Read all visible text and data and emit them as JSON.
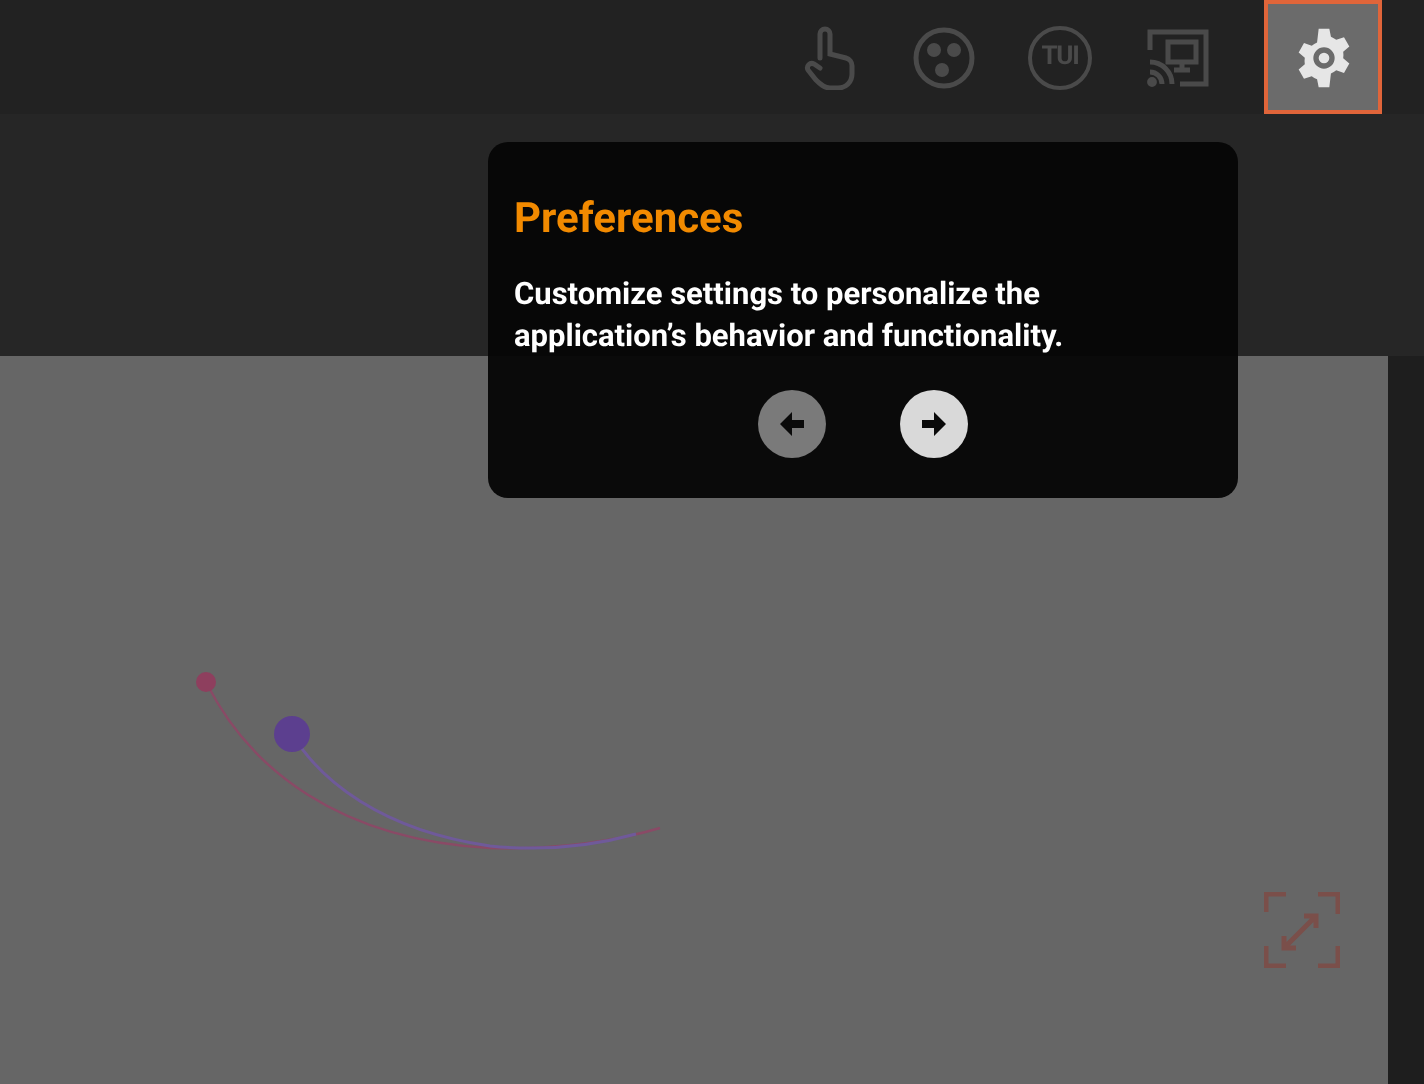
{
  "toolbar": [
    {
      "kind": "touch",
      "selected": false
    },
    {
      "kind": "molecule",
      "selected": false
    },
    {
      "kind": "tui",
      "label": "TUI",
      "selected": false
    },
    {
      "kind": "cast",
      "selected": false
    },
    {
      "kind": "settings",
      "selected": true
    }
  ],
  "tour_popup": {
    "title": "Preferences",
    "body": "Customize settings to personalize the application’s behavior and functionality.",
    "nav": [
      {
        "kind": "back",
        "disabled": true
      },
      {
        "kind": "next",
        "disabled": false
      }
    ]
  }
}
